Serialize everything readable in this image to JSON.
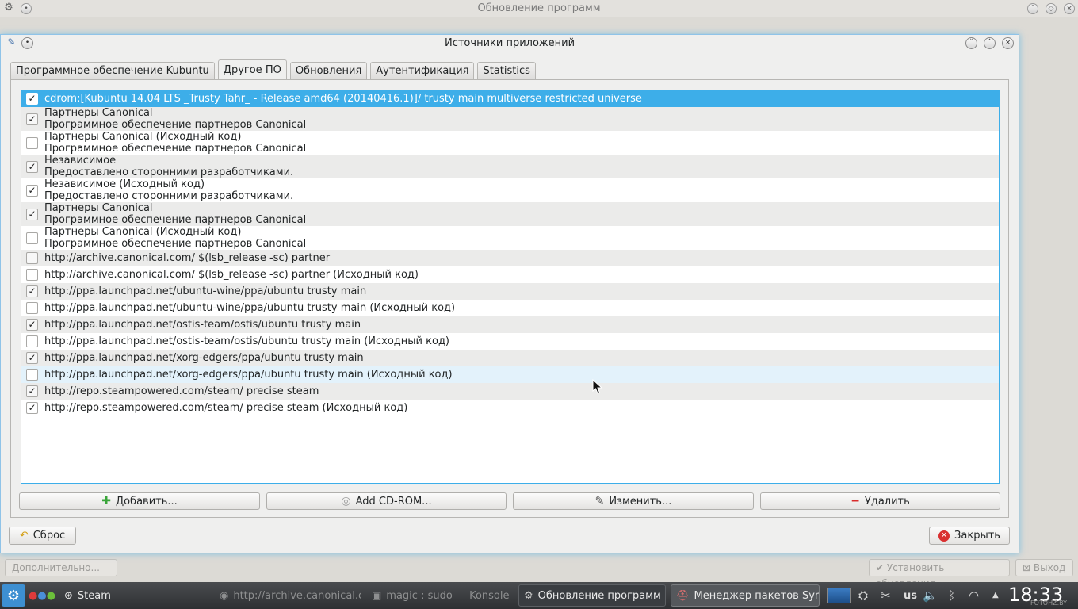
{
  "background_window": {
    "title": "Обновление программ",
    "advanced_button": "Дополнительно...",
    "install_button": "Установить обновления",
    "exit_button": "Выход"
  },
  "dialog": {
    "title": "Источники приложений",
    "tabs": [
      {
        "label": "Программное обеспечение Kubuntu",
        "active": false
      },
      {
        "label": "Другое ПО",
        "active": true
      },
      {
        "label": "Обновления",
        "active": false
      },
      {
        "label": "Аутентификация",
        "active": false
      },
      {
        "label": "Statistics",
        "active": false
      }
    ],
    "sources": [
      {
        "checked": true,
        "line1": "cdrom:[Kubuntu 14.04 LTS _Trusty Tahr_ - Release amd64 (20140416.1)]/ trusty main multiverse restricted universe",
        "line2": ""
      },
      {
        "checked": true,
        "line1": "Партнеры Canonical",
        "line2": "Программное обеспечение партнеров Canonical"
      },
      {
        "checked": false,
        "line1": "Партнеры Canonical (Исходный код)",
        "line2": "Программное обеспечение партнеров Canonical"
      },
      {
        "checked": true,
        "line1": "Независимое",
        "line2": "Предоставлено сторонними разработчиками."
      },
      {
        "checked": true,
        "line1": "Независимое (Исходный код)",
        "line2": "Предоставлено сторонними разработчиками."
      },
      {
        "checked": true,
        "line1": "Партнеры Canonical",
        "line2": "Программное обеспечение партнеров Canonical"
      },
      {
        "checked": false,
        "line1": "Партнеры Canonical (Исходный код)",
        "line2": "Программное обеспечение партнеров Canonical"
      },
      {
        "checked": false,
        "line1": "http://archive.canonical.com/ $(lsb_release -sc) partner",
        "line2": ""
      },
      {
        "checked": false,
        "line1": "http://archive.canonical.com/ $(lsb_release -sc) partner (Исходный код)",
        "line2": ""
      },
      {
        "checked": true,
        "line1": "http://ppa.launchpad.net/ubuntu-wine/ppa/ubuntu trusty main",
        "line2": ""
      },
      {
        "checked": false,
        "line1": "http://ppa.launchpad.net/ubuntu-wine/ppa/ubuntu trusty main (Исходный код)",
        "line2": ""
      },
      {
        "checked": true,
        "line1": "http://ppa.launchpad.net/ostis-team/ostis/ubuntu trusty main",
        "line2": ""
      },
      {
        "checked": false,
        "line1": "http://ppa.launchpad.net/ostis-team/ostis/ubuntu trusty main (Исходный код)",
        "line2": ""
      },
      {
        "checked": true,
        "line1": "http://ppa.launchpad.net/xorg-edgers/ppa/ubuntu trusty main",
        "line2": ""
      },
      {
        "checked": false,
        "line1": "http://ppa.launchpad.net/xorg-edgers/ppa/ubuntu trusty main (Исходный код)",
        "line2": ""
      },
      {
        "checked": true,
        "line1": "http://repo.steampowered.com/steam/ precise steam",
        "line2": ""
      },
      {
        "checked": true,
        "line1": "http://repo.steampowered.com/steam/ precise steam (Исходный код)",
        "line2": ""
      }
    ],
    "buttons": {
      "add": "Добавить...",
      "add_cdrom": "Add CD-ROM...",
      "edit": "Изменить...",
      "remove": "Удалить",
      "reset": "Сброс",
      "close": "Закрыть"
    }
  },
  "taskbar": {
    "tasks": [
      {
        "label": "Steam",
        "state": "normal"
      },
      {
        "label": "http://archive.canonical.co",
        "state": "dim"
      },
      {
        "label": "magic : sudo — Konsole",
        "state": "dim"
      },
      {
        "label": "Обновление программ",
        "state": "normal"
      },
      {
        "label": "Менеджер пакетов Synap",
        "state": "active"
      }
    ],
    "keyboard_layout": "us",
    "clock": "18:33",
    "watermark": "FOTOHZ.BY"
  },
  "colors": {
    "selection": "#3daee9",
    "add_icon": "#3aa53a",
    "remove_icon": "#d92b2b",
    "close_icon": "#d93030"
  }
}
